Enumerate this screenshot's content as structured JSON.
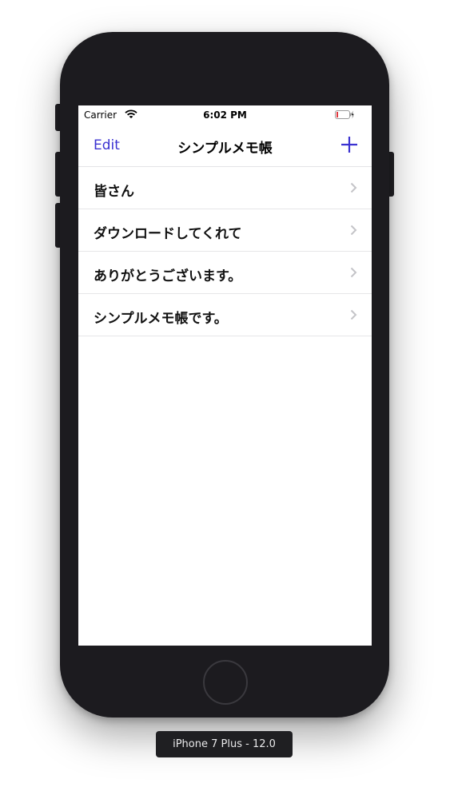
{
  "status_bar": {
    "carrier": "Carrier",
    "time": "6:02 PM",
    "wifi_icon": "wifi-icon",
    "battery_icon": "battery-low-charging-icon",
    "battery_color": "#e0383e"
  },
  "nav": {
    "edit_label": "Edit",
    "title": "シンプルメモ帳",
    "add_icon": "plus-icon",
    "accent_color": "#3b32d1"
  },
  "memos": [
    {
      "label": "皆さん"
    },
    {
      "label": "ダウンロードしてくれて"
    },
    {
      "label": "ありがとうございます。"
    },
    {
      "label": "シンプルメモ帳です。"
    }
  ],
  "row_chevron_icon": "chevron-right-icon",
  "device_label": "iPhone 7 Plus - 12.0"
}
